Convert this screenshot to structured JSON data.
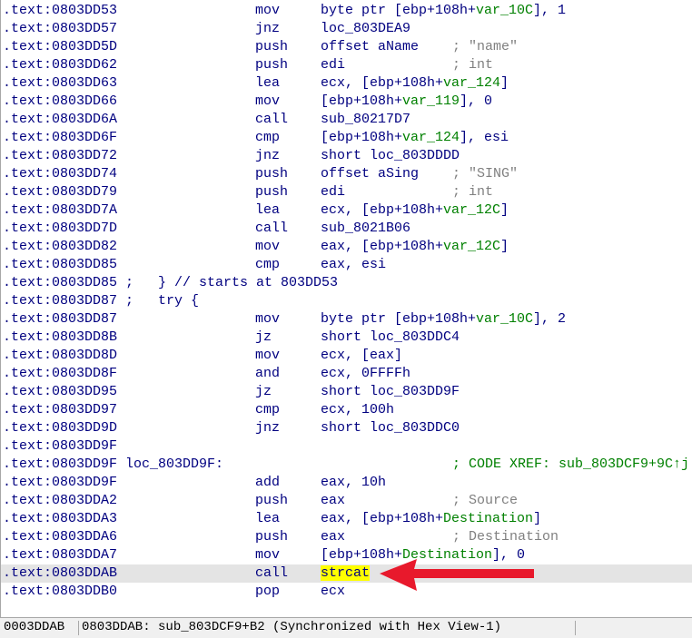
{
  "colors": {
    "text": "#000080",
    "comment": "#808080",
    "variable": "#008000",
    "highlight_row": "#e4e4e4",
    "highlight_word": "#ffff00",
    "arrow": "#e8192c"
  },
  "lines": [
    {
      "addr": ".text:0803DD53",
      "mn": "mov",
      "op": "byte ptr [ebp+108h+",
      "op_var": "var_10C",
      "op_tail": "], 1"
    },
    {
      "addr": ".text:0803DD57",
      "mn": "jnz",
      "op": "loc_803DEA9"
    },
    {
      "addr": ".text:0803DD5D",
      "mn": "push",
      "op": "offset aName",
      "cmt": "; \"name\""
    },
    {
      "addr": ".text:0803DD62",
      "mn": "push",
      "op": "edi",
      "cmt": "; int"
    },
    {
      "addr": ".text:0803DD63",
      "mn": "lea",
      "op": "ecx, [ebp+108h+",
      "op_var": "var_124",
      "op_tail": "]"
    },
    {
      "addr": ".text:0803DD66",
      "mn": "mov",
      "op": "[ebp+108h+",
      "op_var": "var_119",
      "op_tail": "], 0"
    },
    {
      "addr": ".text:0803DD6A",
      "mn": "call",
      "op": "sub_80217D7"
    },
    {
      "addr": ".text:0803DD6F",
      "mn": "cmp",
      "op": "[ebp+108h+",
      "op_var": "var_124",
      "op_tail": "], esi"
    },
    {
      "addr": ".text:0803DD72",
      "mn": "jnz",
      "op": "short loc_803DDDD"
    },
    {
      "addr": ".text:0803DD74",
      "mn": "push",
      "op": "offset aSing",
      "cmt": "; \"SING\""
    },
    {
      "addr": ".text:0803DD79",
      "mn": "push",
      "op": "edi",
      "cmt": "; int"
    },
    {
      "addr": ".text:0803DD7A",
      "mn": "lea",
      "op": "ecx, [ebp+108h+",
      "op_var": "var_12C",
      "op_tail": "]"
    },
    {
      "addr": ".text:0803DD7D",
      "mn": "call",
      "op": "sub_8021B06"
    },
    {
      "addr": ".text:0803DD82",
      "mn": "mov",
      "op": "eax, [ebp+108h+",
      "op_var": "var_12C",
      "op_tail": "]"
    },
    {
      "addr": ".text:0803DD85",
      "mn": "cmp",
      "op": "eax, esi"
    },
    {
      "addr": ".text:0803DD85",
      "label": ";   } // starts at 803DD53"
    },
    {
      "addr": ".text:0803DD87",
      "label": ";   try {"
    },
    {
      "addr": ".text:0803DD87",
      "mn": "mov",
      "op": "byte ptr [ebp+108h+",
      "op_var": "var_10C",
      "op_tail": "], 2"
    },
    {
      "addr": ".text:0803DD8B",
      "mn": "jz",
      "op": "short loc_803DDC4"
    },
    {
      "addr": ".text:0803DD8D",
      "mn": "mov",
      "op": "ecx, [eax]"
    },
    {
      "addr": ".text:0803DD8F",
      "mn": "and",
      "op": "ecx, 0FFFFh"
    },
    {
      "addr": ".text:0803DD95",
      "mn": "jz",
      "op": "short loc_803DD9F"
    },
    {
      "addr": ".text:0803DD97",
      "mn": "cmp",
      "op": "ecx, 100h"
    },
    {
      "addr": ".text:0803DD9D",
      "mn": "jnz",
      "op": "short loc_803DDC0"
    },
    {
      "addr": ".text:0803DD9F"
    },
    {
      "addr": ".text:0803DD9F",
      "label": "loc_803DD9F:",
      "xref": "; CODE XREF: sub_803DCF9+9C↑j"
    },
    {
      "addr": ".text:0803DD9F",
      "mn": "add",
      "op": "eax, 10h"
    },
    {
      "addr": ".text:0803DDA2",
      "mn": "push",
      "op": "eax",
      "cmt": "; Source"
    },
    {
      "addr": ".text:0803DDA3",
      "mn": "lea",
      "op": "eax, [ebp+108h+",
      "op_var": "Destination",
      "op_tail": "]"
    },
    {
      "addr": ".text:0803DDA6",
      "mn": "push",
      "op": "eax",
      "cmt": "; Destination"
    },
    {
      "addr": ".text:0803DDA7",
      "mn": "mov",
      "op": "[ebp+108h+",
      "op_var": "Destination",
      "op_tail": "], 0"
    },
    {
      "addr": ".text:0803DDAB",
      "mn": "call",
      "op_hl": "strcat",
      "highlighted": true
    },
    {
      "addr": ".text:0803DDB0",
      "mn": "pop",
      "op": "ecx"
    }
  ],
  "status": {
    "offset": "0003DDAB",
    "location": "0803DDAB: sub_803DCF9+B2 (Synchronized with Hex View-1)"
  },
  "annotation": {
    "type": "arrow",
    "points_to": "strcat",
    "color": "#e8192c"
  }
}
